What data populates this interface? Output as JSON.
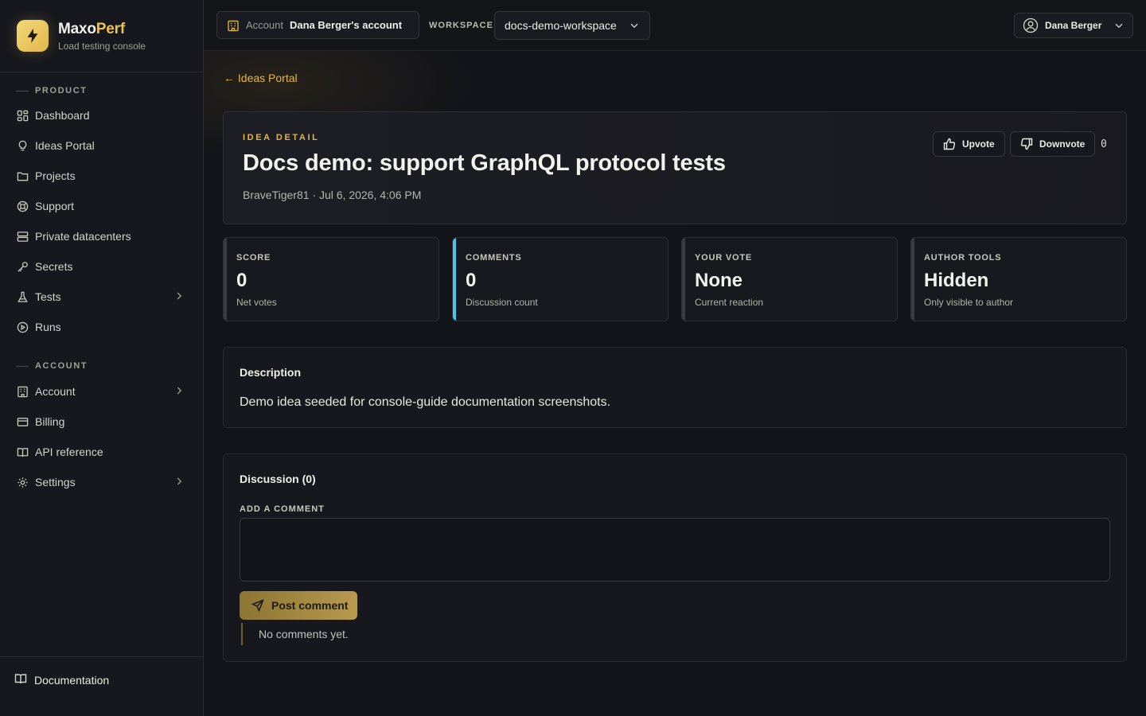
{
  "brand": {
    "name_part1": "Maxo",
    "name_part2": "Perf",
    "subtitle": "Load testing console"
  },
  "sidebar": {
    "sections": [
      {
        "title": "PRODUCT"
      },
      {
        "title": "ACCOUNT"
      }
    ],
    "items": [
      {
        "label": "Dashboard",
        "icon": "dashboard-icon"
      },
      {
        "label": "Ideas Portal",
        "icon": "lightbulb-icon"
      },
      {
        "label": "Projects",
        "icon": "folder-icon"
      },
      {
        "label": "Support",
        "icon": "lifebuoy-icon"
      },
      {
        "label": "Private datacenters",
        "icon": "server-icon"
      },
      {
        "label": "Secrets",
        "icon": "key-icon"
      },
      {
        "label": "Tests",
        "icon": "flask-icon",
        "expandable": true
      },
      {
        "label": "Runs",
        "icon": "play-circle-icon"
      },
      {
        "label": "Account",
        "icon": "building-icon",
        "expandable": true
      },
      {
        "label": "Billing",
        "icon": "credit-card-icon"
      },
      {
        "label": "API reference",
        "icon": "book-icon"
      },
      {
        "label": "Settings",
        "icon": "gear-icon",
        "expandable": true
      }
    ],
    "footer_link": "Documentation"
  },
  "topbar": {
    "account_label": "Account",
    "account_value": "Dana Berger's account",
    "workspace_label": "WORKSPACE",
    "workspace_value": "docs-demo-workspace",
    "user_name": "Dana Berger"
  },
  "main": {
    "back_link": "← Ideas Portal",
    "idea": {
      "eyebrow": "IDEA DETAIL",
      "title": "Docs demo: support GraphQL protocol tests",
      "meta": "BraveTiger81 · Jul 6, 2026, 4:06 PM",
      "upvote_label": "Upvote",
      "downvote_label": "Downvote",
      "vote_count": "0"
    },
    "stats": [
      {
        "label": "SCORE",
        "value": "0",
        "sub": "Net votes",
        "accent": "#3a3b41"
      },
      {
        "label": "COMMENTS",
        "value": "0",
        "sub": "Discussion count",
        "accent": "#4fc3e8"
      },
      {
        "label": "YOUR VOTE",
        "value": "None",
        "sub": "Current reaction",
        "accent": "#3a3b41"
      },
      {
        "label": "AUTHOR TOOLS",
        "value": "Hidden",
        "sub": "Only visible to author",
        "accent": "#3a3b41"
      }
    ],
    "description": {
      "title": "Description",
      "text": "Demo idea seeded for console-guide documentation screenshots."
    },
    "discussion": {
      "title": "Discussion (0)",
      "add_label": "ADD A COMMENT",
      "comment_value": "",
      "post_label": "Post comment",
      "empty_text": "No comments yet."
    }
  }
}
